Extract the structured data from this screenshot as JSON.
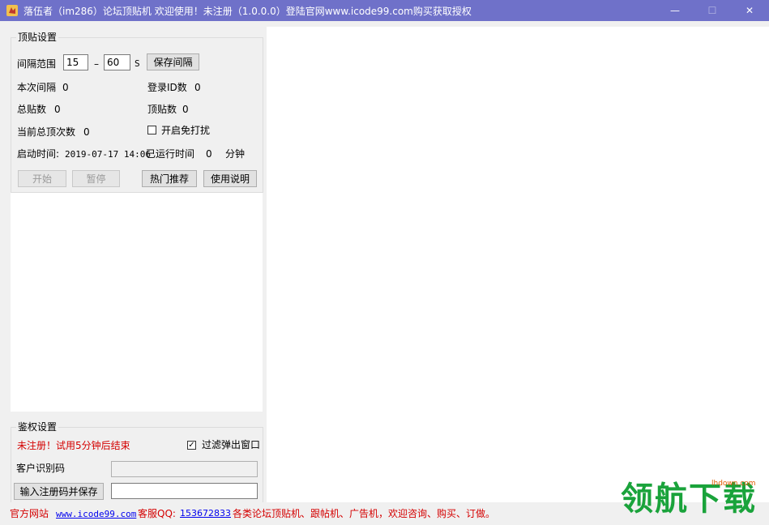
{
  "window": {
    "title": "落伍者（im286）论坛顶贴机  欢迎使用！未注册（1.0.0.0）登陆官网www.icode99.com购买获取授权",
    "minimize": "—",
    "maximize": "☐",
    "close": "✕"
  },
  "top_settings": {
    "legend": "顶贴设置",
    "interval_label": "间隔范围",
    "interval_min": "15",
    "dash": "–",
    "interval_max": "60",
    "unit": "S",
    "save_interval": "保存间隔",
    "this_interval_label": "本次间隔",
    "this_interval_value": "0",
    "login_id_label": "登录ID数",
    "login_id_value": "0",
    "total_posts_label": "总贴数",
    "total_posts_value": "0",
    "top_posts_label": "顶贴数",
    "top_posts_value": "0",
    "current_total_label": "当前总顶次数",
    "current_total_value": "0",
    "no_disturb_label": "开启免打扰",
    "start_time_label": "启动时间:",
    "start_time_value": "2019-07-17 14:06",
    "run_time_label": "已运行时间",
    "run_time_value": "0",
    "run_time_unit": "分钟",
    "start_button": "开始",
    "pause_button": "暂停",
    "hot_button": "热门推荐",
    "help_button": "使用说明"
  },
  "auth_settings": {
    "legend": "鉴权设置",
    "trial_notice": "未注册！试用5分钟后结束",
    "filter_popup_label": "过滤弹出窗口",
    "filter_popup_checked": "✓",
    "client_code_label": "客户识别码",
    "client_code_value": "",
    "register_button": "输入注册码并保存",
    "register_code_value": ""
  },
  "status_bar": {
    "site_label": "官方网站",
    "site_link": "www.icode99.com",
    "qq_label": "客服QQ:",
    "qq_value": "153672833",
    "slogan": "各类论坛顶贴机、跟帖机、广告机，欢迎咨询、购买、订做。"
  },
  "watermark": {
    "text": "领航下载",
    "sub": "lhdown.com"
  },
  "colors": {
    "titlebar": "#6f71c9",
    "status_red": "#d40000",
    "watermark_green": "#1aa33b"
  }
}
